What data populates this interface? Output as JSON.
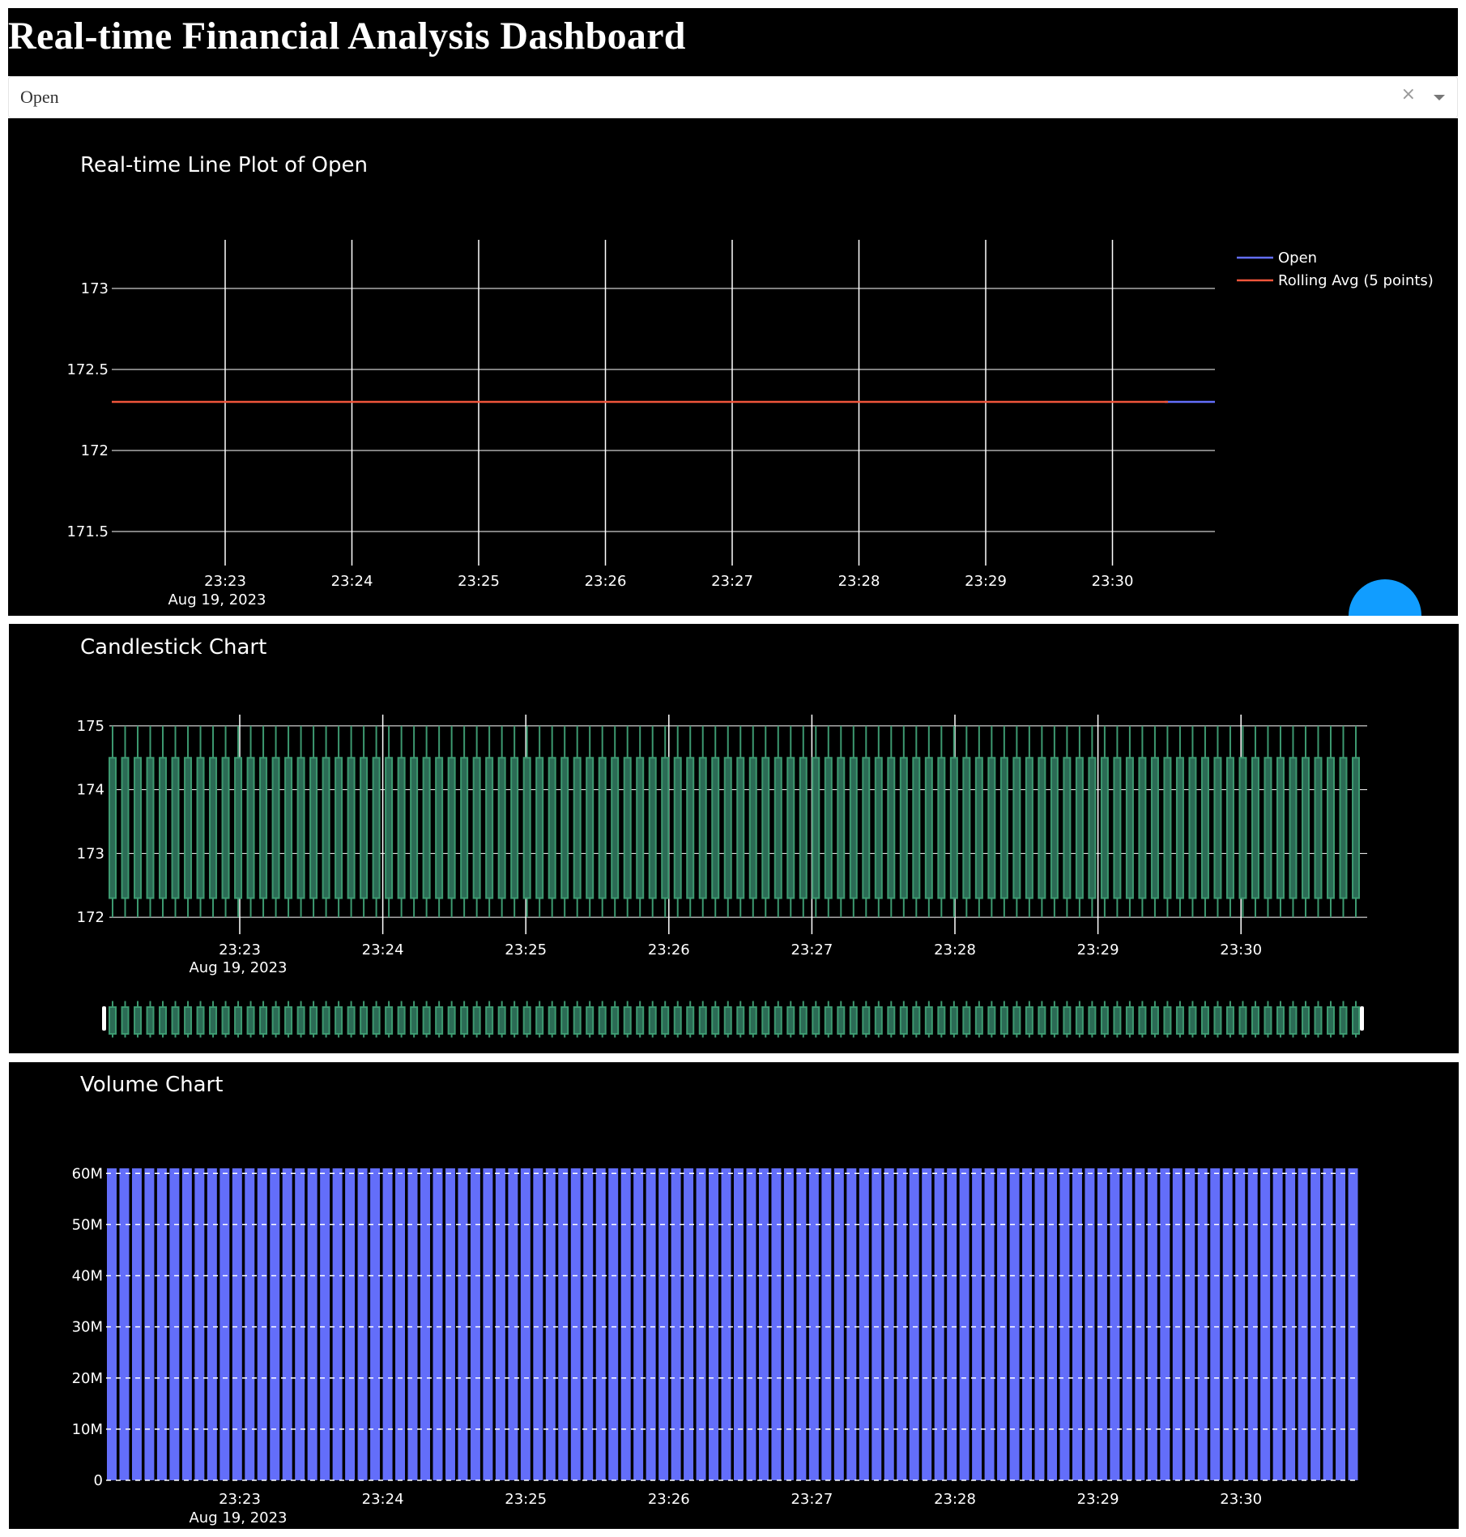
{
  "header": {
    "title": "Real-time Financial Analysis Dashboard"
  },
  "dropdown": {
    "value": "Open",
    "clear_icon": "×"
  },
  "colors": {
    "open_line": "#636efa",
    "rolling_line": "#ef553b",
    "candle": "#2ca02c",
    "candle_increasing": "#3d9970",
    "volume_bar": "#636efa",
    "modebar_button": "#119dff"
  },
  "line_chart": {
    "title": "Real-time Line Plot of Open",
    "legend": [
      "Open",
      "Rolling Avg (5 points)"
    ],
    "x_ticks": [
      "23:23",
      "23:24",
      "23:25",
      "23:26",
      "23:27",
      "23:28",
      "23:29",
      "23:30"
    ],
    "x_date": "Aug 19, 2023",
    "y_ticks": [
      "173",
      "172.5",
      "172",
      "171.5"
    ]
  },
  "candle_chart": {
    "title": "Candlestick Chart",
    "x_ticks": [
      "23:23",
      "23:24",
      "23:25",
      "23:26",
      "23:27",
      "23:28",
      "23:29",
      "23:30"
    ],
    "x_date": "Aug 19, 2023",
    "y_ticks": [
      "175",
      "174",
      "173",
      "172"
    ]
  },
  "volume_chart": {
    "title": "Volume Chart",
    "x_ticks": [
      "23:23",
      "23:24",
      "23:25",
      "23:26",
      "23:27",
      "23:28",
      "23:29",
      "23:30"
    ],
    "x_date": "Aug 19, 2023",
    "y_ticks": [
      "60M",
      "50M",
      "40M",
      "30M",
      "20M",
      "10M",
      "0"
    ]
  },
  "chart_data": [
    {
      "type": "line",
      "title": "Real-time Line Plot of Open",
      "x": [
        "23:22:07",
        "23:30:45"
      ],
      "x_tick_labels": [
        "23:23",
        "23:24",
        "23:25",
        "23:26",
        "23:27",
        "23:28",
        "23:29",
        "23:30"
      ],
      "x_date": "Aug 19, 2023",
      "series": [
        {
          "name": "Open",
          "values": [
            172.3,
            172.3
          ],
          "color": "#636efa"
        },
        {
          "name": "Rolling Avg (5 points)",
          "values": [
            172.3,
            172.3
          ],
          "color": "#ef553b"
        }
      ],
      "ylim": [
        171.3,
        173.3
      ],
      "legend": "top-right",
      "grid": true
    },
    {
      "type": "candlestick",
      "title": "Candlestick Chart",
      "x_tick_labels": [
        "23:23",
        "23:24",
        "23:25",
        "23:26",
        "23:27",
        "23:28",
        "23:29",
        "23:30"
      ],
      "x_date": "Aug 19, 2023",
      "ohlc": {
        "open": 172.3,
        "high": 175.0,
        "low": 172.0,
        "close": 174.5
      },
      "count": 100,
      "ylim": [
        171.9,
        175.1
      ],
      "rangeslider": true,
      "grid": true
    },
    {
      "type": "bar",
      "title": "Volume Chart",
      "x_tick_labels": [
        "23:23",
        "23:24",
        "23:25",
        "23:26",
        "23:27",
        "23:28",
        "23:29",
        "23:30"
      ],
      "x_date": "Aug 19, 2023",
      "value": 61000000,
      "count": 100,
      "ylim": [
        0,
        61000000
      ],
      "grid": true
    }
  ]
}
